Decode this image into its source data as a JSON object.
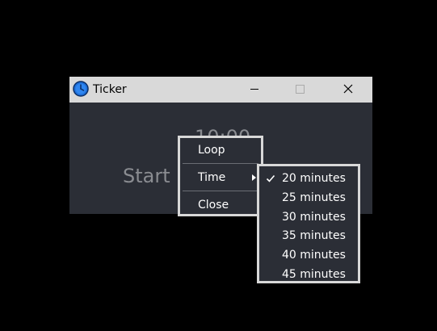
{
  "window": {
    "title": "Ticker",
    "icon": "clock-icon",
    "controls": {
      "minimize_icon": "minimize-icon",
      "maximize_icon": "maximize-icon",
      "close_icon": "close-icon"
    }
  },
  "app": {
    "timer_display": "10:00",
    "start_label": "Start"
  },
  "context_menu": {
    "items": [
      {
        "label": "Loop"
      },
      {
        "label": "Time",
        "has_submenu": true
      },
      {
        "label": "Close"
      }
    ]
  },
  "time_submenu": {
    "selected": "20 minutes",
    "items": [
      {
        "label": "20 minutes",
        "checked": true
      },
      {
        "label": "25 minutes",
        "checked": false
      },
      {
        "label": "30 minutes",
        "checked": false
      },
      {
        "label": "35 minutes",
        "checked": false
      },
      {
        "label": "40 minutes",
        "checked": false
      },
      {
        "label": "45 minutes",
        "checked": false
      }
    ]
  },
  "colors": {
    "titlebar": "#d9d9d9",
    "client_background": "#2b2e36",
    "menu_border": "#d8d8d8",
    "menu_text": "#ffffff",
    "dim_text": "#8a8c91",
    "icon_blue": "#1e6fd9"
  }
}
